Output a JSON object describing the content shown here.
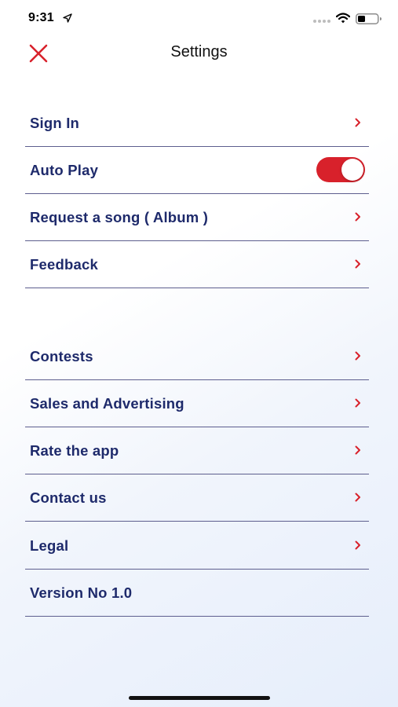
{
  "status_bar": {
    "time": "9:31",
    "icons": [
      "location-arrow-icon",
      "signal-icon",
      "wifi-icon",
      "battery-icon"
    ]
  },
  "nav": {
    "title": "Settings",
    "close_icon": "close-icon"
  },
  "colors": {
    "accent": "#d8212b",
    "label": "#1e2a6b",
    "divider": "#5d5e8e"
  },
  "group1": {
    "sign_in": "Sign In",
    "auto_play": "Auto Play",
    "auto_play_on": true,
    "request_song": "Request a song ( Album )",
    "feedback": "Feedback"
  },
  "group2": {
    "contests": "Contests",
    "sales": "Sales and Advertising",
    "rate": "Rate the app",
    "contact": "Contact us",
    "legal": "Legal",
    "version": "Version No 1.0"
  }
}
